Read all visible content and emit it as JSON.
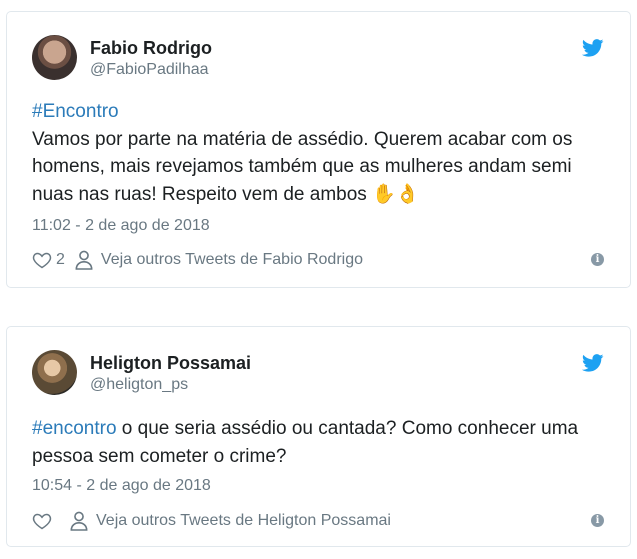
{
  "tweets": [
    {
      "author_name": "Fabio Rodrigo",
      "author_handle": "@FabioPadilhaa",
      "hashtag": "#Encontro",
      "text": "Vamos por parte na matéria de assédio. Querem acabar com os homens, mais revejamos também que as mulheres andam semi nuas nas ruas! Respeito vem de ambos",
      "emojis": "✋👌",
      "timestamp": "11:02 - 2 de ago de 2018",
      "likes": "2",
      "see_more_label": "Veja outros Tweets de Fabio Rodrigo",
      "icons": [
        "twitter-bird-icon",
        "heart-icon",
        "person-icon",
        "info-icon"
      ]
    },
    {
      "author_name": "Heligton Possamai",
      "author_handle": "@heligton_ps",
      "hashtag": "#encontro",
      "text": "o que seria assédio ou cantada? Como conhecer uma pessoa sem cometer o crime?",
      "timestamp": "10:54 - 2 de ago de 2018",
      "see_more_label": "Veja outros Tweets de Heligton Possamai",
      "icons": [
        "twitter-bird-icon",
        "heart-icon",
        "person-icon",
        "info-icon"
      ]
    }
  ],
  "colors": {
    "link": "#2b7bb9",
    "twitter_blue": "#1da1f2",
    "secondary_text": "#697882",
    "border": "#e1e8ed"
  }
}
